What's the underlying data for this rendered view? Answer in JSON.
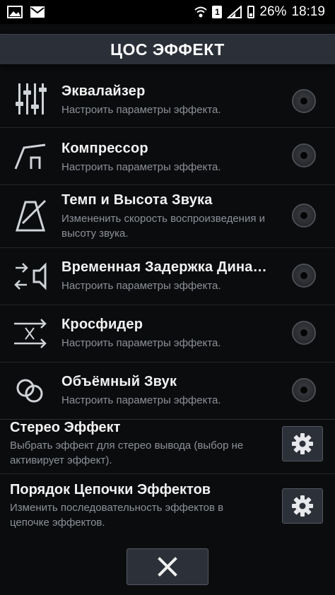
{
  "status_bar": {
    "battery": "26%",
    "time": "18:19",
    "sim": "1"
  },
  "title": "ЦОС ЭФФЕКТ",
  "effects": [
    {
      "name": "Эквалайзер",
      "desc": "Настроить параметры эффекта.",
      "icon": "equalizer-icon"
    },
    {
      "name": "Компрессор",
      "desc": "Настроить параметры эффекта.",
      "icon": "compressor-icon"
    },
    {
      "name": "Темп и Высота Звука",
      "desc": "Измененить скорость воспроизведения и высоту звука.",
      "icon": "metronome-icon"
    },
    {
      "name": "Временная Задержка Дина…",
      "desc": "Настроить параметры эффекта.",
      "icon": "speaker-delay-icon"
    },
    {
      "name": "Кросфидер",
      "desc": "Настроить параметры эффекта.",
      "icon": "crossfader-icon"
    },
    {
      "name": "Объёмный Звук",
      "desc": "Настроить параметры эффекта.",
      "icon": "surround-icon"
    }
  ],
  "settings": [
    {
      "name": "Стерео Эффект",
      "desc": "Выбрать эффект для стерео вывода (выбор не активирует эффект).",
      "icon": "gear-icon"
    },
    {
      "name": "Порядок Цепочки Эффектов",
      "desc": "Изменить последовательность эффектов в цепочке эффектов.",
      "icon": "gear-icon"
    }
  ],
  "close_icon": "close-icon"
}
